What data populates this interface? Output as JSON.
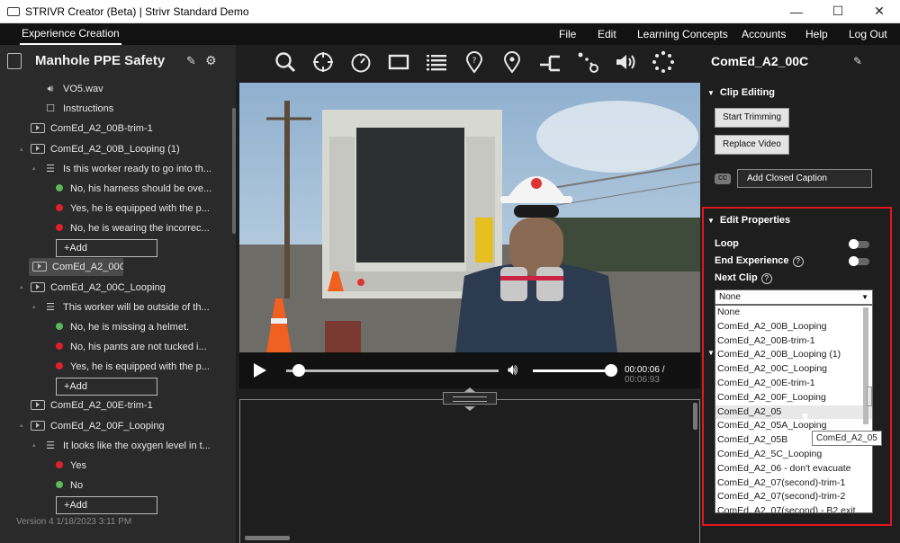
{
  "window": {
    "title": "STRIVR Creator (Beta) | Strivr Standard Demo",
    "minimize": "—",
    "maximize": "☐",
    "close": "✕"
  },
  "menubar": {
    "active_tab": "Experience Creation",
    "items": [
      "File",
      "Edit",
      "Learning Concepts",
      "Accounts",
      "Help",
      "Log Out"
    ]
  },
  "project": {
    "title": "Manhole PPE Safety",
    "version": "Version 4   1/18/2023 3:11 PM"
  },
  "tree": {
    "audio": "VO5.wav",
    "instructions": "Instructions",
    "clip1": "ComEd_A2_00B-trim-1",
    "clip2": "ComEd_A2_00B_Looping (1)",
    "q1": "Is this worker ready to go into th...",
    "q1_answers": [
      "No, his harness should be ove...",
      "Yes, he is equipped with the p...",
      "No, he is wearing the incorrec..."
    ],
    "add": "+Add",
    "clip3": "ComEd_A2_00C",
    "clip4": "ComEd_A2_00C_Looping",
    "q2": "This worker will be outside of th...",
    "q2_answers": [
      "No, he is missing a helmet.",
      "No, his pants are not tucked i...",
      "Yes, he is equipped with the p..."
    ],
    "clip5": "ComEd_A2_00E-trim-1",
    "clip6": "ComEd_A2_00F_Looping",
    "q3": "It looks like the oxygen level in t...",
    "q3_answers": [
      "Yes",
      "No"
    ]
  },
  "player": {
    "current_time": "00:00:06",
    "separator": " / ",
    "duration": "00:06:93",
    "progress": 0.03,
    "volume": 1.0
  },
  "right_panel": {
    "clip_name": "ComEd_A2_00C",
    "clip_editing": "Clip Editing",
    "start_trimming": "Start Trimming",
    "replace_video": "Replace Video",
    "cc_badge": "CC",
    "add_cc": "Add Closed Caption",
    "edit_properties": "Edit Properties",
    "loop": "Loop",
    "end_experience": "End Experience",
    "next_clip": "Next Clip",
    "help_glyph": "?",
    "selected_next": "None",
    "options": [
      "None",
      "ComEd_A2_00B_Looping",
      "ComEd_A2_00B-trim-1",
      "ComEd_A2_00B_Looping (1)",
      "ComEd_A2_00C_Looping",
      "ComEd_A2_00E-trim-1",
      "ComEd_A2_00F_Looping",
      "ComEd_A2_05",
      "ComEd_A2_05A_Looping",
      "ComEd_A2_05B",
      "ComEd_A2_5C_Looping",
      "ComEd_A2_06 - don't evacuate",
      "ComEd_A2_07(second)-trim-1",
      "ComEd_A2_07(second)-trim-2",
      "ComEd_A2_07(second) - B2 exit"
    ],
    "hovered_option": "ComEd_A2_05",
    "tooltip": "ComEd_A2_05"
  },
  "colors": {
    "highlight_frame": "#e2161d",
    "correct": "#5cb85c",
    "incorrect": "#e0202a"
  }
}
